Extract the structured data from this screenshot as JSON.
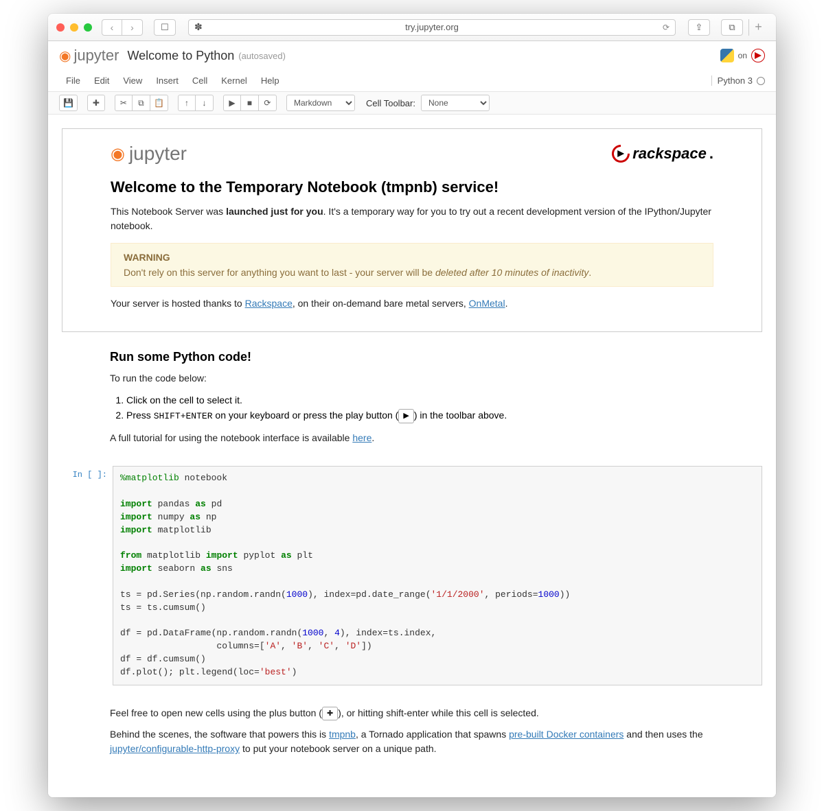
{
  "browser": {
    "url": "try.jupyter.org"
  },
  "header": {
    "logo_text": "jupyter",
    "title": "Welcome to Python",
    "autosave": "(autosaved)",
    "on_label": "on"
  },
  "menubar": {
    "items": [
      "File",
      "Edit",
      "View",
      "Insert",
      "Cell",
      "Kernel",
      "Help"
    ],
    "kernel": "Python 3"
  },
  "toolbar": {
    "cell_type": "Markdown",
    "cell_toolbar_label": "Cell Toolbar:",
    "cell_toolbar_value": "None"
  },
  "welcome": {
    "logo_text": "jupyter",
    "sponsor": "rackspace",
    "heading": "Welcome to the Temporary Notebook (tmpnb) service!",
    "para1_a": "This Notebook Server was ",
    "para1_b": "launched just for you",
    "para1_c": ". It's a temporary way for you to try out a recent development version of the IPython/Jupyter notebook.",
    "warn_title": "WARNING",
    "warn_a": "Don't rely on this server for anything you want to last - your server will be ",
    "warn_b": "deleted after 10 minutes of inactivity",
    "hosted_a": "Your server is hosted thanks to ",
    "hosted_link1": "Rackspace",
    "hosted_b": ", on their on-demand bare metal servers, ",
    "hosted_link2": "OnMetal",
    "hosted_c": "."
  },
  "run": {
    "heading": "Run some Python code!",
    "instr": "To run the code below:",
    "step1": "Click on the cell to select it.",
    "step2a": "Press ",
    "step2_kbd": "SHIFT+ENTER",
    "step2b": " on your keyboard or press the play button (",
    "step2c": ") in the toolbar above.",
    "tutorial_a": "A full tutorial for using the notebook interface is available ",
    "tutorial_link": "here",
    "tutorial_b": "."
  },
  "code": {
    "prompt": "In [ ]:"
  },
  "footer": {
    "p1a": "Feel free to open new cells using the plus button (",
    "p1b": "), or hitting shift-enter while this cell is selected.",
    "p2a": "Behind the scenes, the software that powers this is ",
    "p2_link1": "tmpnb",
    "p2b": ", a Tornado application that spawns ",
    "p2_link2": "pre-built Docker containers",
    "p2c": " and then uses the ",
    "p2_link3": "jupyter/configurable-http-proxy",
    "p2d": " to put your notebook server on a unique path."
  }
}
